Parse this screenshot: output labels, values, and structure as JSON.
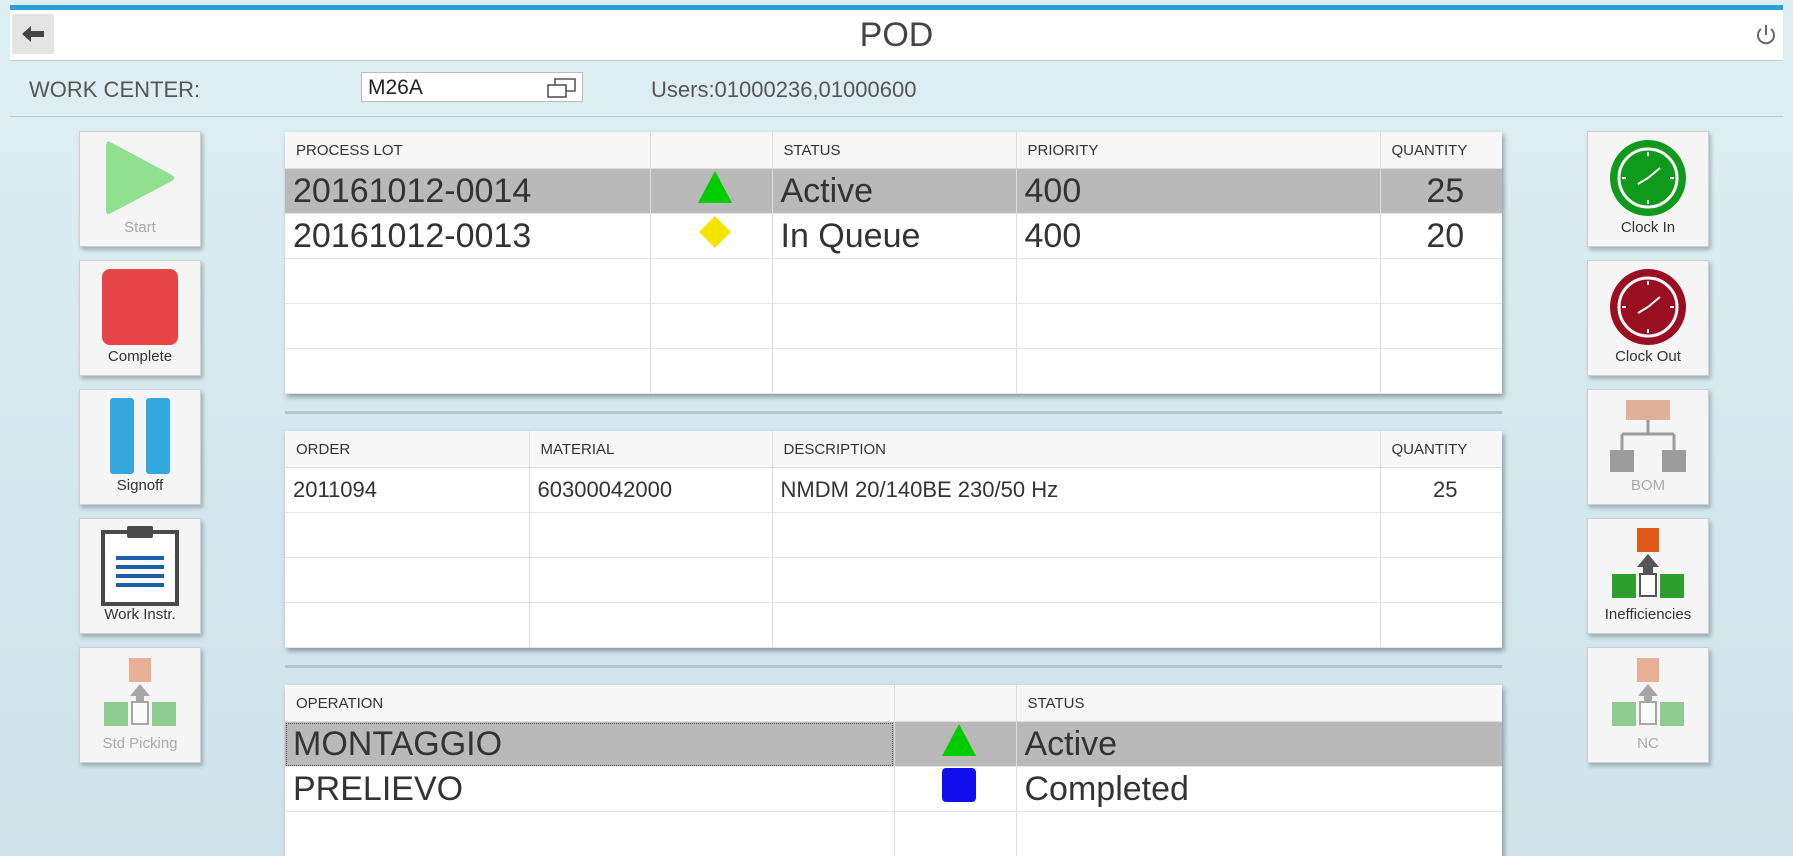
{
  "header": {
    "title": "POD"
  },
  "workcenter": {
    "label": "WORK CENTER:",
    "value": "M26A",
    "users": "Users:01000236,01000600"
  },
  "left_buttons": [
    {
      "label": "Start",
      "icon": "play-icon",
      "enabled": false
    },
    {
      "label": "Complete",
      "icon": "stop-icon",
      "enabled": true
    },
    {
      "label": "Signoff",
      "icon": "pause-icon",
      "enabled": true
    },
    {
      "label": "Work Instr.",
      "icon": "clipboard-icon",
      "enabled": true
    },
    {
      "label": "Std Picking",
      "icon": "picking-icon",
      "enabled": false
    }
  ],
  "right_buttons": [
    {
      "label": "Clock In",
      "icon": "clock-in-icon",
      "enabled": true
    },
    {
      "label": "Clock Out",
      "icon": "clock-out-icon",
      "enabled": true
    },
    {
      "label": "BOM",
      "icon": "bom-icon",
      "enabled": false
    },
    {
      "label": "Inefficiencies",
      "icon": "inefficiencies-icon",
      "enabled": true
    },
    {
      "label": "NC",
      "icon": "nc-icon",
      "enabled": false
    }
  ],
  "process_lots": {
    "columns": [
      "PROCESS LOT",
      "",
      "STATUS",
      "PRIORITY",
      "QUANTITY"
    ],
    "rows": [
      {
        "lot": "20161012-0014",
        "status_icon": "green-triangle-icon",
        "status": "Active",
        "priority": "400",
        "quantity": "25",
        "selected": true
      },
      {
        "lot": "20161012-0013",
        "status_icon": "yellow-diamond-icon",
        "status": "In Queue",
        "priority": "400",
        "quantity": "20",
        "selected": false
      }
    ]
  },
  "orders": {
    "columns": [
      "ORDER",
      "MATERIAL",
      "DESCRIPTION",
      "QUANTITY"
    ],
    "rows": [
      {
        "order": "2011094",
        "material": "60300042000",
        "description": "NMDM 20/140BE 230/50 Hz",
        "quantity": "25"
      }
    ]
  },
  "operations": {
    "columns": [
      "OPERATION",
      "",
      "STATUS"
    ],
    "rows": [
      {
        "operation": "MONTAGGIO",
        "status_icon": "green-triangle-icon",
        "status": "Active",
        "selected": true
      },
      {
        "operation": "PRELIEVO",
        "status_icon": "blue-square-icon",
        "status": "Completed",
        "selected": false
      }
    ]
  },
  "colors": {
    "accent": "#2a9fd8",
    "active": "#00cc00",
    "queue": "#f5e400",
    "completed": "#1010ee",
    "selected_row": "#b9b9b9"
  }
}
